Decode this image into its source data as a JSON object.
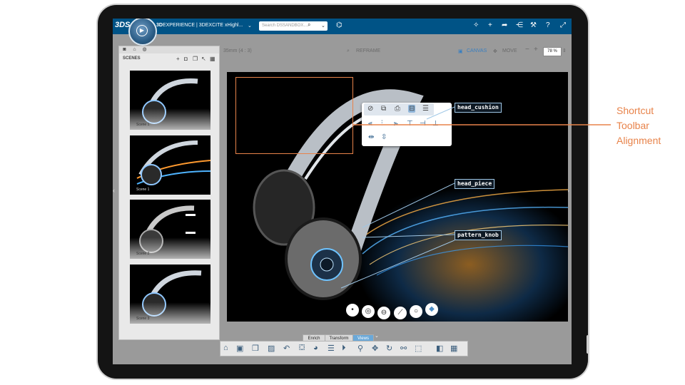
{
  "app": {
    "brand_logo": "3DS",
    "compass_label": "▶",
    "title_bold": "3D",
    "title_rest": "EXPERIENCE | 3DEXCITE xHighl...",
    "search_placeholder": "Search DSSANDBOX..."
  },
  "top_icons": [
    "tag-icon",
    "plus-icon",
    "share-arrow-icon",
    "network-icon",
    "tools-icon",
    "help-icon",
    "fullscreen-icon"
  ],
  "scenes_panel": {
    "title": "SCENES",
    "tabs": [
      "camera-icon",
      "object-icon",
      "material-icon"
    ],
    "thumbnails": [
      {
        "label": "Scene 1"
      },
      {
        "label": "Scene 1"
      },
      {
        "label": "Scene 2"
      },
      {
        "label": "Scene 3"
      }
    ]
  },
  "canvas_bar": {
    "lens": "35mm (4 : 3)",
    "reframe": "REFRAME",
    "canvas": "CANVAS",
    "move": "MOVE",
    "zoom": "78 %"
  },
  "viewport": {
    "tags": [
      "head_cushion",
      "head_piece",
      "pattern_knob"
    ],
    "popup_row1": [
      "hide-icon",
      "copy-icon",
      "print-icon",
      "align-icon",
      "menu-icon"
    ],
    "popup_row2": [
      "align-left-icon",
      "align-center-icon",
      "align-right-icon",
      "align-top-icon",
      "align-middle-icon",
      "align-bottom-icon"
    ],
    "popup_row3": [
      "distribute-horizontal-icon",
      "distribute-vertical-icon"
    ],
    "circle_tools": [
      "point-icon",
      "target-icon",
      "ring-icon",
      "slash-icon",
      "circle-icon",
      "cube-icon"
    ]
  },
  "annotation": [
    "Shortcut",
    "Toolbar",
    "Alignment"
  ],
  "bottom_tabs": [
    "Enrich",
    "Transform",
    "Views"
  ],
  "bottom_toolbar": [
    "home-icon",
    "save-icon",
    "view-cube-icon",
    "render-icon",
    "undo-icon",
    "scene-icon",
    "sphere-icon",
    "layers-icon",
    "play-icon",
    "zoom-icon",
    "pan-icon",
    "rotate-icon",
    "lasso-icon",
    "box-icon",
    "material-icon",
    "environment-icon"
  ]
}
